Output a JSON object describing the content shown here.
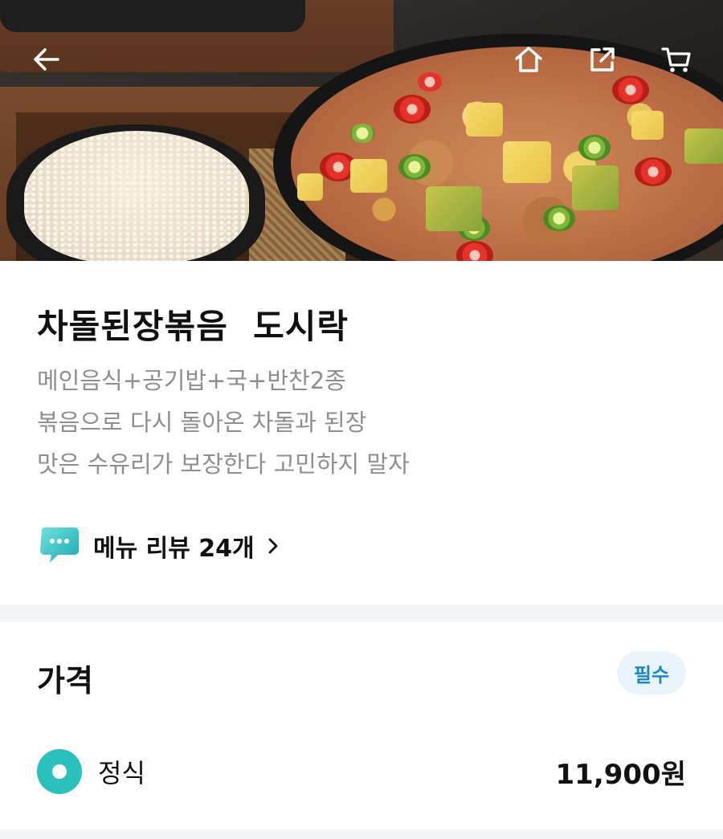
{
  "nav": {
    "back_icon": "back-arrow-icon",
    "home_icon": "home-icon",
    "share_icon": "share-icon",
    "cart_icon": "cart-icon"
  },
  "menu": {
    "title": "차돌된장볶음  도시락",
    "description_lines": [
      "메인음식+공기밥+국+반찬2종",
      "볶음으로 다시 돌아온 차돌과 된장",
      "맛은 수유리가 보장한다 고민하지 말자"
    ],
    "review_link": "메뉴 리뷰 24개"
  },
  "price_section": {
    "title": "가격",
    "required_badge": "필수",
    "options": [
      {
        "label": "정식",
        "price": "11,900원",
        "selected": true
      }
    ]
  },
  "colors": {
    "accent": "#2ac1bc",
    "badge_bg": "#eaf5fb",
    "badge_text": "#1a86c9",
    "muted_text": "#8e8e8e"
  }
}
